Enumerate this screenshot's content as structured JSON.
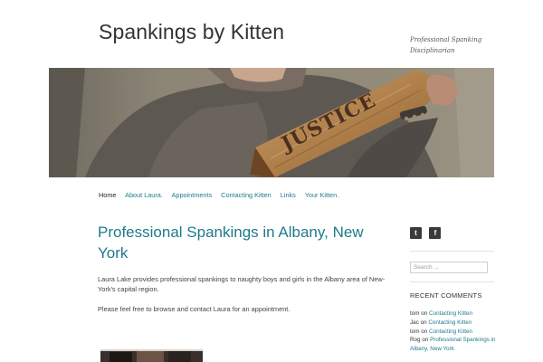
{
  "site": {
    "title": "Spankings by Kitten",
    "tagline": "Professional Spanking Disciplinarian",
    "header_image_text": "JUSTICE"
  },
  "nav": {
    "items": [
      "Home",
      "About Laura.",
      "Appointments",
      "Contacting Kitten",
      "Links",
      "Your Kitten."
    ],
    "current": "Home"
  },
  "post": {
    "title": "Professional Spankings in Albany, New York",
    "paragraphs": [
      "Laura Lake provides professional spankings to naughty boys and girls in the Albany area of New-York's capital region.",
      "Please feel free to browse and contact Laura for an appointment."
    ]
  },
  "sidebar": {
    "social": [
      {
        "icon": "twitter-icon",
        "glyph": "t"
      },
      {
        "icon": "facebook-icon",
        "glyph": "f"
      }
    ],
    "search_placeholder": "Search ...",
    "recent_comments": {
      "title": "RECENT COMMENTS",
      "on_word": "on",
      "items": [
        {
          "author": "tom",
          "post": "Contacting Kitten"
        },
        {
          "author": "Jac",
          "post": "Contacting Kitten"
        },
        {
          "author": "tom",
          "post": "Contacting Kitten"
        },
        {
          "author": "Rog",
          "post": "Professional Spankings in Albany, New York"
        }
      ]
    }
  },
  "colors": {
    "link": "#1f7a8c",
    "title_link": "#1f7a8c",
    "text": "#333333"
  }
}
